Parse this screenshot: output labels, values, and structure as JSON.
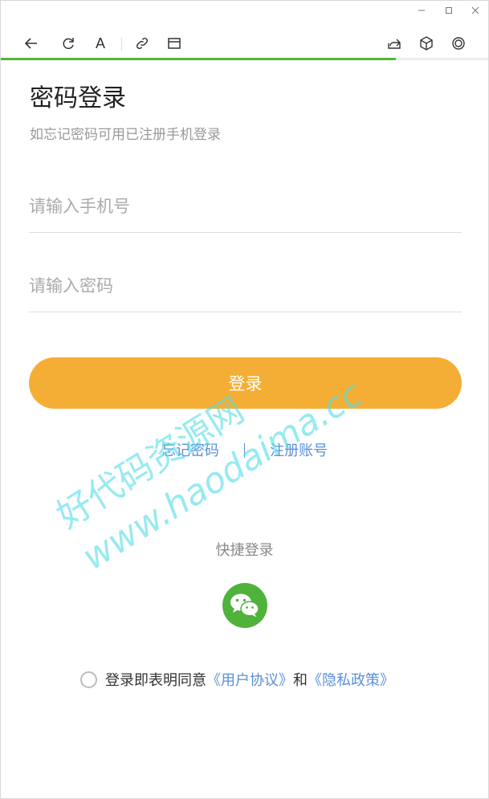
{
  "window": {
    "minimize_icon": "minimize-icon",
    "maximize_icon": "maximize-icon",
    "close_icon": "close-icon"
  },
  "toolbar": {
    "font_label": "A",
    "progress_fraction": 0.81,
    "progress_color": "#55b537"
  },
  "page": {
    "title": "密码登录",
    "subtitle": "如忘记密码可用已注册手机登录",
    "phone_placeholder": "请输入手机号",
    "password_placeholder": "请输入密码",
    "login_button": "登录",
    "forgot_link": "忘记密码",
    "register_link": "注册账号",
    "quick_login_label": "快捷登录",
    "agree_prefix": "登录即表明同意",
    "user_agreement": "《用户协议》",
    "agree_and": "和",
    "privacy_policy": "《隐私政策》"
  },
  "watermark": {
    "line1": "好代码资源网",
    "line2": "www.haodaima.cc"
  },
  "colors": {
    "accent": "#f5ae35",
    "link": "#5b8fd9",
    "wechat": "#4fb23b"
  }
}
